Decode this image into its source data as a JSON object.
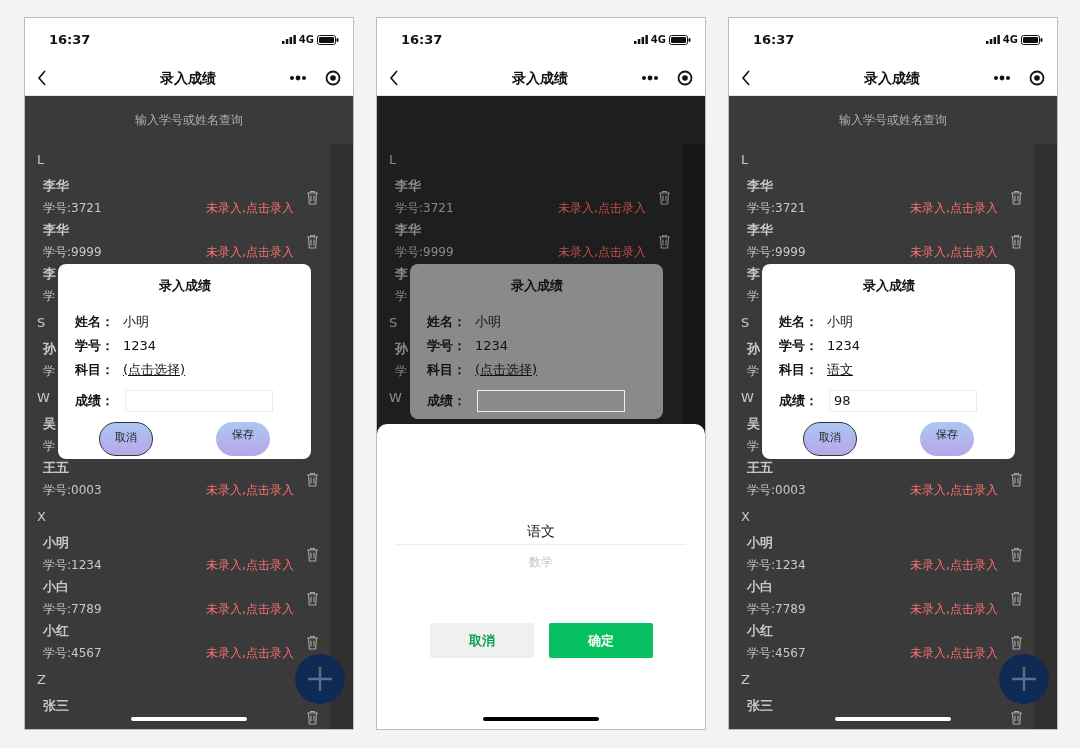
{
  "phones": [
    {
      "dimmed": false,
      "status_bar": {
        "time": "16:37",
        "network": "4G"
      },
      "nav": {
        "title": "录入成绩"
      },
      "search": {
        "placeholder": "输入学号或姓名查询"
      },
      "add_button": true,
      "sections": [
        {
          "letter": "L",
          "items": [
            {
              "name": "李华",
              "student_id": "学号:3721",
              "status": "未录入,点击录入",
              "deletable": true
            },
            {
              "name": "李华",
              "student_id": "学号:9999",
              "status": "未录入,点击录入",
              "deletable": true
            },
            {
              "name": "李",
              "student_id": "学",
              "deletable": false
            }
          ]
        },
        {
          "letter": "S",
          "items": [
            {
              "name": "孙",
              "student_id": "学",
              "deletable": false
            }
          ]
        },
        {
          "letter": "W",
          "items": [
            {
              "name": "吴",
              "student_id": "学",
              "deletable": false
            },
            {
              "name": "王五",
              "student_id": "学号:0003",
              "status": "未录入,点击录入",
              "deletable": true
            }
          ]
        },
        {
          "letter": "X",
          "items": [
            {
              "name": "小明",
              "student_id": "学号:1234",
              "status": "未录入,点击录入",
              "deletable": true
            },
            {
              "name": "小白",
              "student_id": "学号:7789",
              "status": "未录入,点击录入",
              "deletable": true
            },
            {
              "name": "小红",
              "student_id": "学号:4567",
              "status": "未录入,点击录入",
              "deletable": true
            }
          ]
        },
        {
          "letter": "Z",
          "items": [
            {
              "name": "张三",
              "deletable": true
            }
          ]
        }
      ],
      "dialog": {
        "title": "录入成绩",
        "fields": [
          {
            "label": "姓名：",
            "value": "小明",
            "kind": "text"
          },
          {
            "label": "学号：",
            "value": "1234",
            "kind": "text"
          },
          {
            "label": "科目：",
            "value": "(点击选择)",
            "kind": "link"
          },
          {
            "label": "成绩：",
            "kind": "input"
          }
        ],
        "buttons": [
          {
            "label": "取消",
            "outlined": true
          },
          {
            "label": "保存",
            "outlined": false
          }
        ]
      }
    },
    {
      "dimmed": true,
      "status_bar": {
        "time": "16:37",
        "network": "4G"
      },
      "nav": {
        "title": "录入成绩"
      },
      "add_button": false,
      "sections": [
        {
          "letter": "L",
          "items": [
            {
              "name": "李华",
              "student_id": "学号:3721",
              "status": "未录入,点击录入",
              "deletable": true
            },
            {
              "name": "李华",
              "student_id": "学号:9999",
              "status": "未录入,点击录入",
              "deletable": true
            },
            {
              "name": "李",
              "student_id": "学",
              "deletable": false
            }
          ]
        },
        {
          "letter": "S",
          "items": [
            {
              "name": "孙",
              "student_id": "学",
              "deletable": false
            }
          ]
        },
        {
          "letter": "W"
        }
      ],
      "dialog": {
        "title": "录入成绩",
        "fields": [
          {
            "label": "姓名：",
            "value": "小明",
            "kind": "text"
          },
          {
            "label": "学号：",
            "value": "1234",
            "kind": "text"
          },
          {
            "label": "科目：",
            "value": "(点击选择)",
            "kind": "link"
          },
          {
            "label": "成绩：",
            "kind": "input"
          }
        ]
      },
      "picker": {
        "options": [
          {
            "label": "语文",
            "selected": true
          },
          {
            "label": "数学",
            "selected": false
          }
        ],
        "buttons": [
          {
            "label": "取消",
            "kind": "cancel"
          },
          {
            "label": "确定",
            "kind": "confirm"
          }
        ]
      }
    },
    {
      "dimmed": false,
      "status_bar": {
        "time": "16:37",
        "network": "4G"
      },
      "nav": {
        "title": "录入成绩"
      },
      "search": {
        "placeholder": "输入学号或姓名查询"
      },
      "add_button": true,
      "sections": [
        {
          "letter": "L",
          "items": [
            {
              "name": "李华",
              "student_id": "学号:3721",
              "status": "未录入,点击录入",
              "deletable": true
            },
            {
              "name": "李华",
              "student_id": "学号:9999",
              "status": "未录入,点击录入",
              "deletable": true
            },
            {
              "name": "李",
              "student_id": "学",
              "deletable": false
            }
          ]
        },
        {
          "letter": "S",
          "items": [
            {
              "name": "孙",
              "student_id": "学",
              "deletable": false
            }
          ]
        },
        {
          "letter": "W",
          "items": [
            {
              "name": "吴",
              "student_id": "学",
              "deletable": false
            },
            {
              "name": "王五",
              "student_id": "学号:0003",
              "status": "未录入,点击录入",
              "deletable": true
            }
          ]
        },
        {
          "letter": "X",
          "items": [
            {
              "name": "小明",
              "student_id": "学号:1234",
              "status": "未录入,点击录入",
              "deletable": true
            },
            {
              "name": "小白",
              "student_id": "学号:7789",
              "status": "未录入,点击录入",
              "deletable": true
            },
            {
              "name": "小红",
              "student_id": "学号:4567",
              "status": "未录入,点击录入",
              "deletable": true
            }
          ]
        },
        {
          "letter": "Z",
          "items": [
            {
              "name": "张三",
              "deletable": true
            }
          ]
        }
      ],
      "dialog": {
        "title": "录入成绩",
        "fields": [
          {
            "label": "姓名：",
            "value": "小明",
            "kind": "text"
          },
          {
            "label": "学号：",
            "value": "1234",
            "kind": "text"
          },
          {
            "label": "科目：",
            "value": "语文",
            "kind": "link"
          },
          {
            "label": "成绩：",
            "value": "98",
            "kind": "input"
          }
        ],
        "buttons": [
          {
            "label": "取消",
            "outlined": true
          },
          {
            "label": "保存",
            "outlined": false
          }
        ]
      }
    }
  ]
}
